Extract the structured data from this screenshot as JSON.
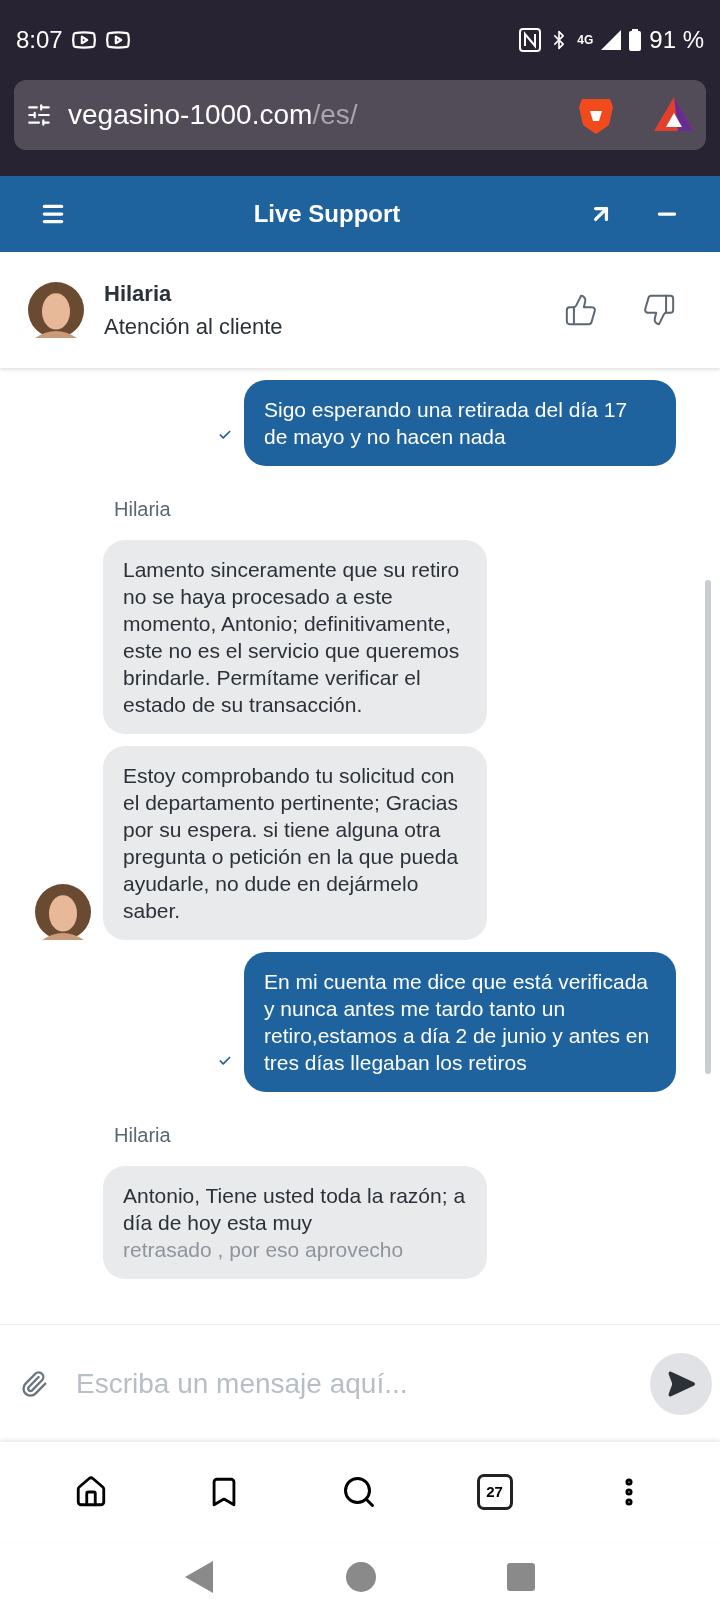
{
  "status_bar": {
    "time": "8:07",
    "network": "4G",
    "battery": "91 %"
  },
  "browser": {
    "url_host": "vegasino-1000.com",
    "url_path": "/es/"
  },
  "chat_header": {
    "title": "Live Support"
  },
  "agent": {
    "name": "Hilaria",
    "role": "Atención al cliente"
  },
  "messages": [
    {
      "kind": "user",
      "text": "Sigo esperando una retirada del día 17 de mayo y no hacen nada",
      "delivered": true
    },
    {
      "kind": "agent_name",
      "text": "Hilaria"
    },
    {
      "kind": "agent",
      "text": "Lamento sinceramente que su retiro no se haya procesado a este momento, Antonio; definitivamente, este no es el servicio que queremos brindarle. Permítame verificar el estado de su transacción.",
      "avatar": false
    },
    {
      "kind": "agent",
      "text": "Estoy comprobando tu solicitud con el departamento pertinente; Gracias por su espera. si tiene alguna otra pregunta o petición en la que pueda ayudarle, no dude en dejármelo saber.",
      "avatar": true
    },
    {
      "kind": "user",
      "text": "En mi cuenta me dice que está verificada y nunca antes me tardo tanto un retiro,estamos a día 2 de junio y antes en tres días llegaban los retiros",
      "delivered": true
    },
    {
      "kind": "agent_name",
      "text": "Hilaria"
    },
    {
      "kind": "agent",
      "text": "Antonio, Tiene usted toda la razón; a día de hoy esta muy",
      "faded_text": "retrasado , por eso aprovecho",
      "avatar": false
    }
  ],
  "composer": {
    "placeholder": "Escriba un mensaje aquí..."
  },
  "nav": {
    "tabs_count": "27"
  }
}
